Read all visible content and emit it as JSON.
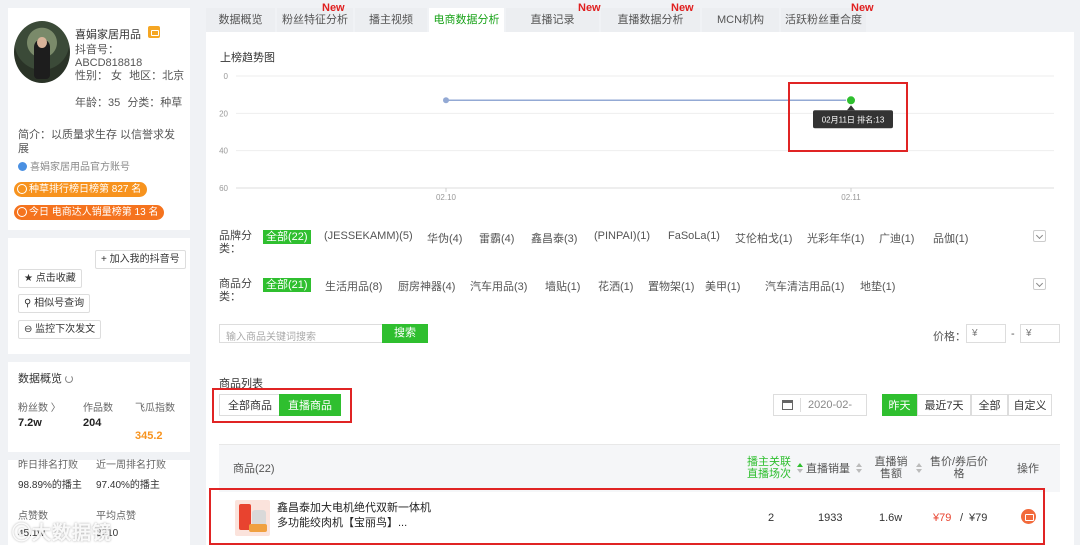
{
  "profile": {
    "name": "喜娟家居用品",
    "id_label": "抖音号：",
    "id_value": "ABCD818818",
    "gender": "性别：  女",
    "region": "地区：北京",
    "age": "年龄：35",
    "category": "分类：种草",
    "intro": "简介：以质量求生存 以信誉求发展",
    "official": "喜娟家居用品官方账号",
    "rank1": "种草排行榜日榜第 827 名",
    "rank2": "今日 电商达人销量榜第 13 名"
  },
  "sidebar_actions": {
    "add_my": "+ 加入我的抖音号",
    "favorite": "★ 点击收藏",
    "similar": "相似号查询",
    "monitor": "监控下次发文"
  },
  "overview": {
    "title": "数据概览",
    "fans_label": "粉丝数 〉",
    "fans_value": "7.2w",
    "works_label": "作品数",
    "works_value": "204",
    "index_label": "飞瓜指数",
    "index_value": "345.2",
    "beat_day_label": "昨日排名打败",
    "beat_day_value": "98.89%的播主",
    "beat_week_label": "近一周排名打败",
    "beat_week_value": "97.40%的播主",
    "likes_label": "点赞数",
    "likes_value": "45.1w",
    "avg_label": "平均点赞",
    "avg_value": "2210"
  },
  "watermark": "大数据镜",
  "tabs": [
    {
      "label": "数据概览",
      "new": false
    },
    {
      "label": "粉丝特征分析",
      "new": true
    },
    {
      "label": "播主视频",
      "new": false
    },
    {
      "label": "电商数据分析",
      "new": false,
      "active": true
    },
    {
      "label": "直播记录",
      "new": true
    },
    {
      "label": "直播数据分析",
      "new": true
    },
    {
      "label": "MCN机构",
      "new": false
    },
    {
      "label": "活跃粉丝重合度",
      "new": true
    }
  ],
  "new_label": "New",
  "chart_data": {
    "type": "line",
    "title": "上榜趋势图",
    "x": [
      "02.10",
      "02.11"
    ],
    "series": [
      {
        "values": [
          13,
          13
        ],
        "color": "#93a9d4"
      }
    ],
    "ylim": [
      0,
      60
    ],
    "y_inverted": true,
    "yticks": [
      0,
      20,
      40,
      60
    ],
    "grid": true,
    "tooltip": "02月11日 排名:13",
    "highlight_color": "#2fbf2f"
  },
  "brand_filter": {
    "label": "品牌分类：",
    "items": [
      "全部(22)",
      "(JESSEKAMM)(5)",
      "华伪(4)",
      "雷霸(4)",
      "鑫昌泰(3)",
      "(PINPAI)(1)",
      "FaSoLa(1)",
      "艾伦柏戈(1)",
      "光彩年华(1)",
      "广迪(1)",
      "品伽(1)"
    ]
  },
  "product_filter": {
    "label": "商品分类：",
    "items": [
      "全部(21)",
      "生活用品(8)",
      "厨房神器(4)",
      "汽车用品(3)",
      "墙贴(1)",
      "花洒(1)",
      "置物架(1)",
      "美甲(1)",
      "汽车清洁用品(1)",
      "地垫(1)"
    ]
  },
  "search": {
    "placeholder": "输入商品关键词搜索",
    "button": "搜索"
  },
  "price": {
    "label": "价格：",
    "min": "¥",
    "max": "¥",
    "dash": "-"
  },
  "list": {
    "title": "商品列表",
    "seg_all": "全部商品",
    "seg_live": "直播商品",
    "date": "2020-02-",
    "ranges": [
      "昨天",
      "最近7天",
      "全部",
      "自定义"
    ]
  },
  "table": {
    "headers": {
      "product": "商品(22)",
      "related": "播主关联直播场次",
      "sales": "直播销量",
      "amount": "直播销售额",
      "price": "售价/券后价格",
      "op": "操作"
    },
    "rows": [
      {
        "name": "鑫昌泰加大电机绝代双新一体机 多功能绞肉机【宝丽鸟】...",
        "related": "2",
        "sales": "1933",
        "amount": "1.6w",
        "price": "¥79",
        "coupon": "¥79",
        "slash": "/"
      }
    ]
  }
}
